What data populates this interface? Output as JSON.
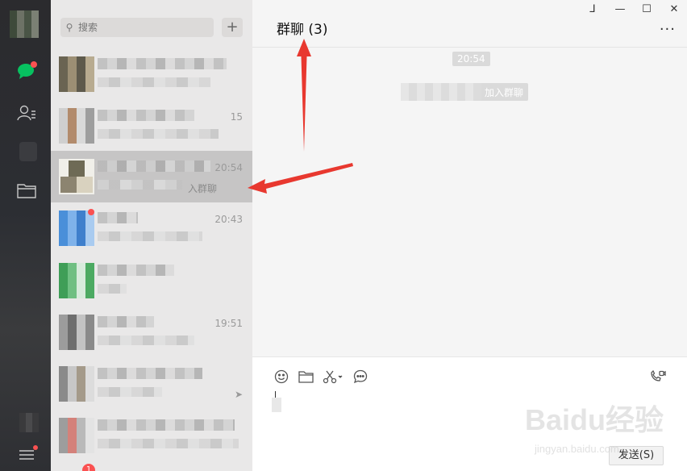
{
  "window": {
    "controls": [
      "⅃",
      "—",
      "☐",
      "✕"
    ]
  },
  "search": {
    "placeholder": "搜索",
    "add_label": "+"
  },
  "chat_list": [
    {
      "time": "",
      "tail": ""
    },
    {
      "time": "15",
      "tail": ""
    },
    {
      "time": "20:54",
      "tail": "入群聊",
      "selected": true
    },
    {
      "time": "20:43",
      "tail": ""
    },
    {
      "time": "",
      "tail": ""
    },
    {
      "time": "19:51",
      "tail": ""
    },
    {
      "time": "",
      "tail": ""
    },
    {
      "time": "",
      "tail": ""
    }
  ],
  "chat": {
    "title": "群聊 (3)",
    "more_label": "···",
    "timestamp": "20:54",
    "system_message": "加入群聊"
  },
  "input": {
    "send_label": "发送(S)"
  },
  "badges": {
    "bottom_count": "1"
  },
  "watermark": {
    "line1": "Baidu经验",
    "line2": "jingyan.baidu.com"
  },
  "colors": {
    "accent_green": "#07c160",
    "badge_red": "#fa5151",
    "arrow_red": "#e8382f"
  }
}
